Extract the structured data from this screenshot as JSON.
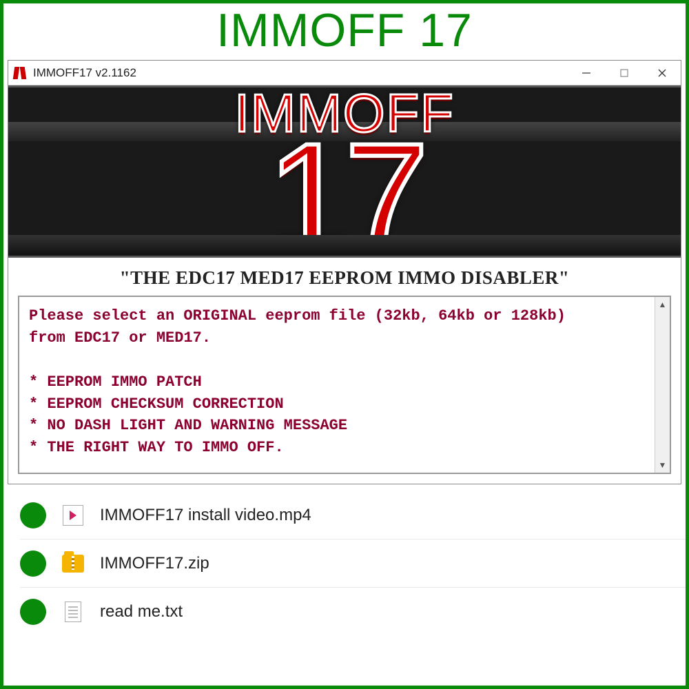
{
  "page": {
    "title": "IMMOFF 17"
  },
  "window": {
    "title": "IMMOFF17 v2.1162",
    "banner": {
      "line1": "IMMOFF",
      "line2": "17"
    },
    "subtitle": "\"THE EDC17 MED17 EEPROM IMMO DISABLER\"",
    "body": "Please select an ORIGINAL eeprom file (32kb, 64kb or 128kb)\nfrom EDC17 or MED17.\n\n* EEPROM IMMO PATCH\n* EEPROM CHECKSUM CORRECTION\n* NO DASH LIGHT AND WARNING MESSAGE\n* THE RIGHT WAY TO IMMO OFF."
  },
  "files": [
    {
      "icon": "video",
      "name": "IMMOFF17 install video.mp4"
    },
    {
      "icon": "zip",
      "name": "IMMOFF17.zip"
    },
    {
      "icon": "txt",
      "name": "read me.txt"
    }
  ]
}
